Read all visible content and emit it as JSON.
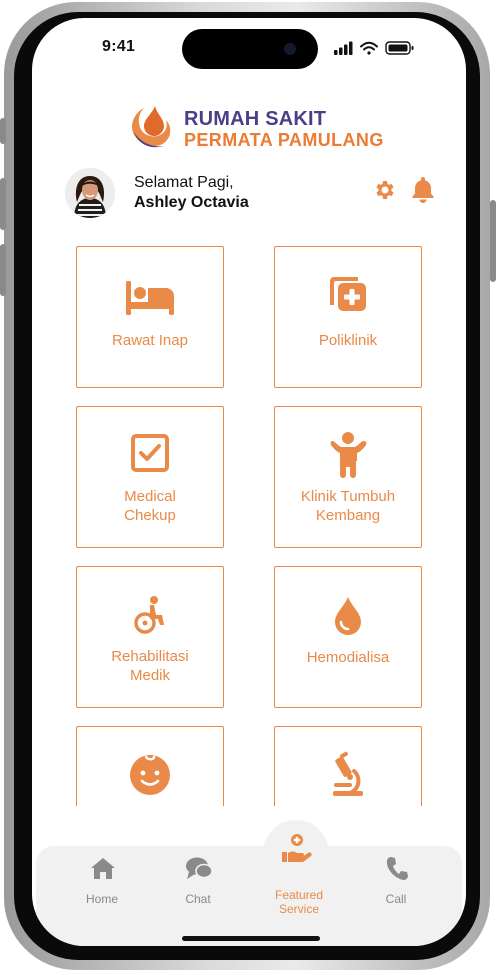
{
  "status": {
    "time": "9:41"
  },
  "brand": {
    "line1": "RUMAH SAKIT",
    "line2": "PERMATA PAMULANG",
    "primary_color": "#4b3f87",
    "accent_color": "#ea7c34"
  },
  "user": {
    "greeting": "Selamat Pagi,",
    "name": "Ashley Octavia"
  },
  "header_icons": [
    "gear-icon",
    "bell-icon"
  ],
  "services": [
    {
      "label_lines": [
        "Rawat Inap"
      ],
      "icon": "bed-icon"
    },
    {
      "label_lines": [
        "Poliklinik"
      ],
      "icon": "first-aid-icon"
    },
    {
      "label_lines": [
        "Medical",
        "Chekup"
      ],
      "icon": "checkbox-icon"
    },
    {
      "label_lines": [
        "Klinik Tumbuh",
        "Kembang"
      ],
      "icon": "child-icon"
    },
    {
      "label_lines": [
        "Rehabilitasi",
        "Medik"
      ],
      "icon": "wheelchair-icon"
    },
    {
      "label_lines": [
        "Hemodialisa"
      ],
      "icon": "drop-icon"
    },
    {
      "label_lines": [],
      "icon": "baby-face-icon"
    },
    {
      "label_lines": [],
      "icon": "microscope-icon"
    }
  ],
  "tabs": [
    {
      "label": "Home",
      "icon": "home-icon"
    },
    {
      "label": "Chat",
      "icon": "chat-icon"
    },
    {
      "label_lines": [
        "Featured",
        "Service"
      ],
      "icon": "hand-heart-icon",
      "active": true
    },
    {
      "label": "Call",
      "icon": "phone-icon"
    }
  ]
}
